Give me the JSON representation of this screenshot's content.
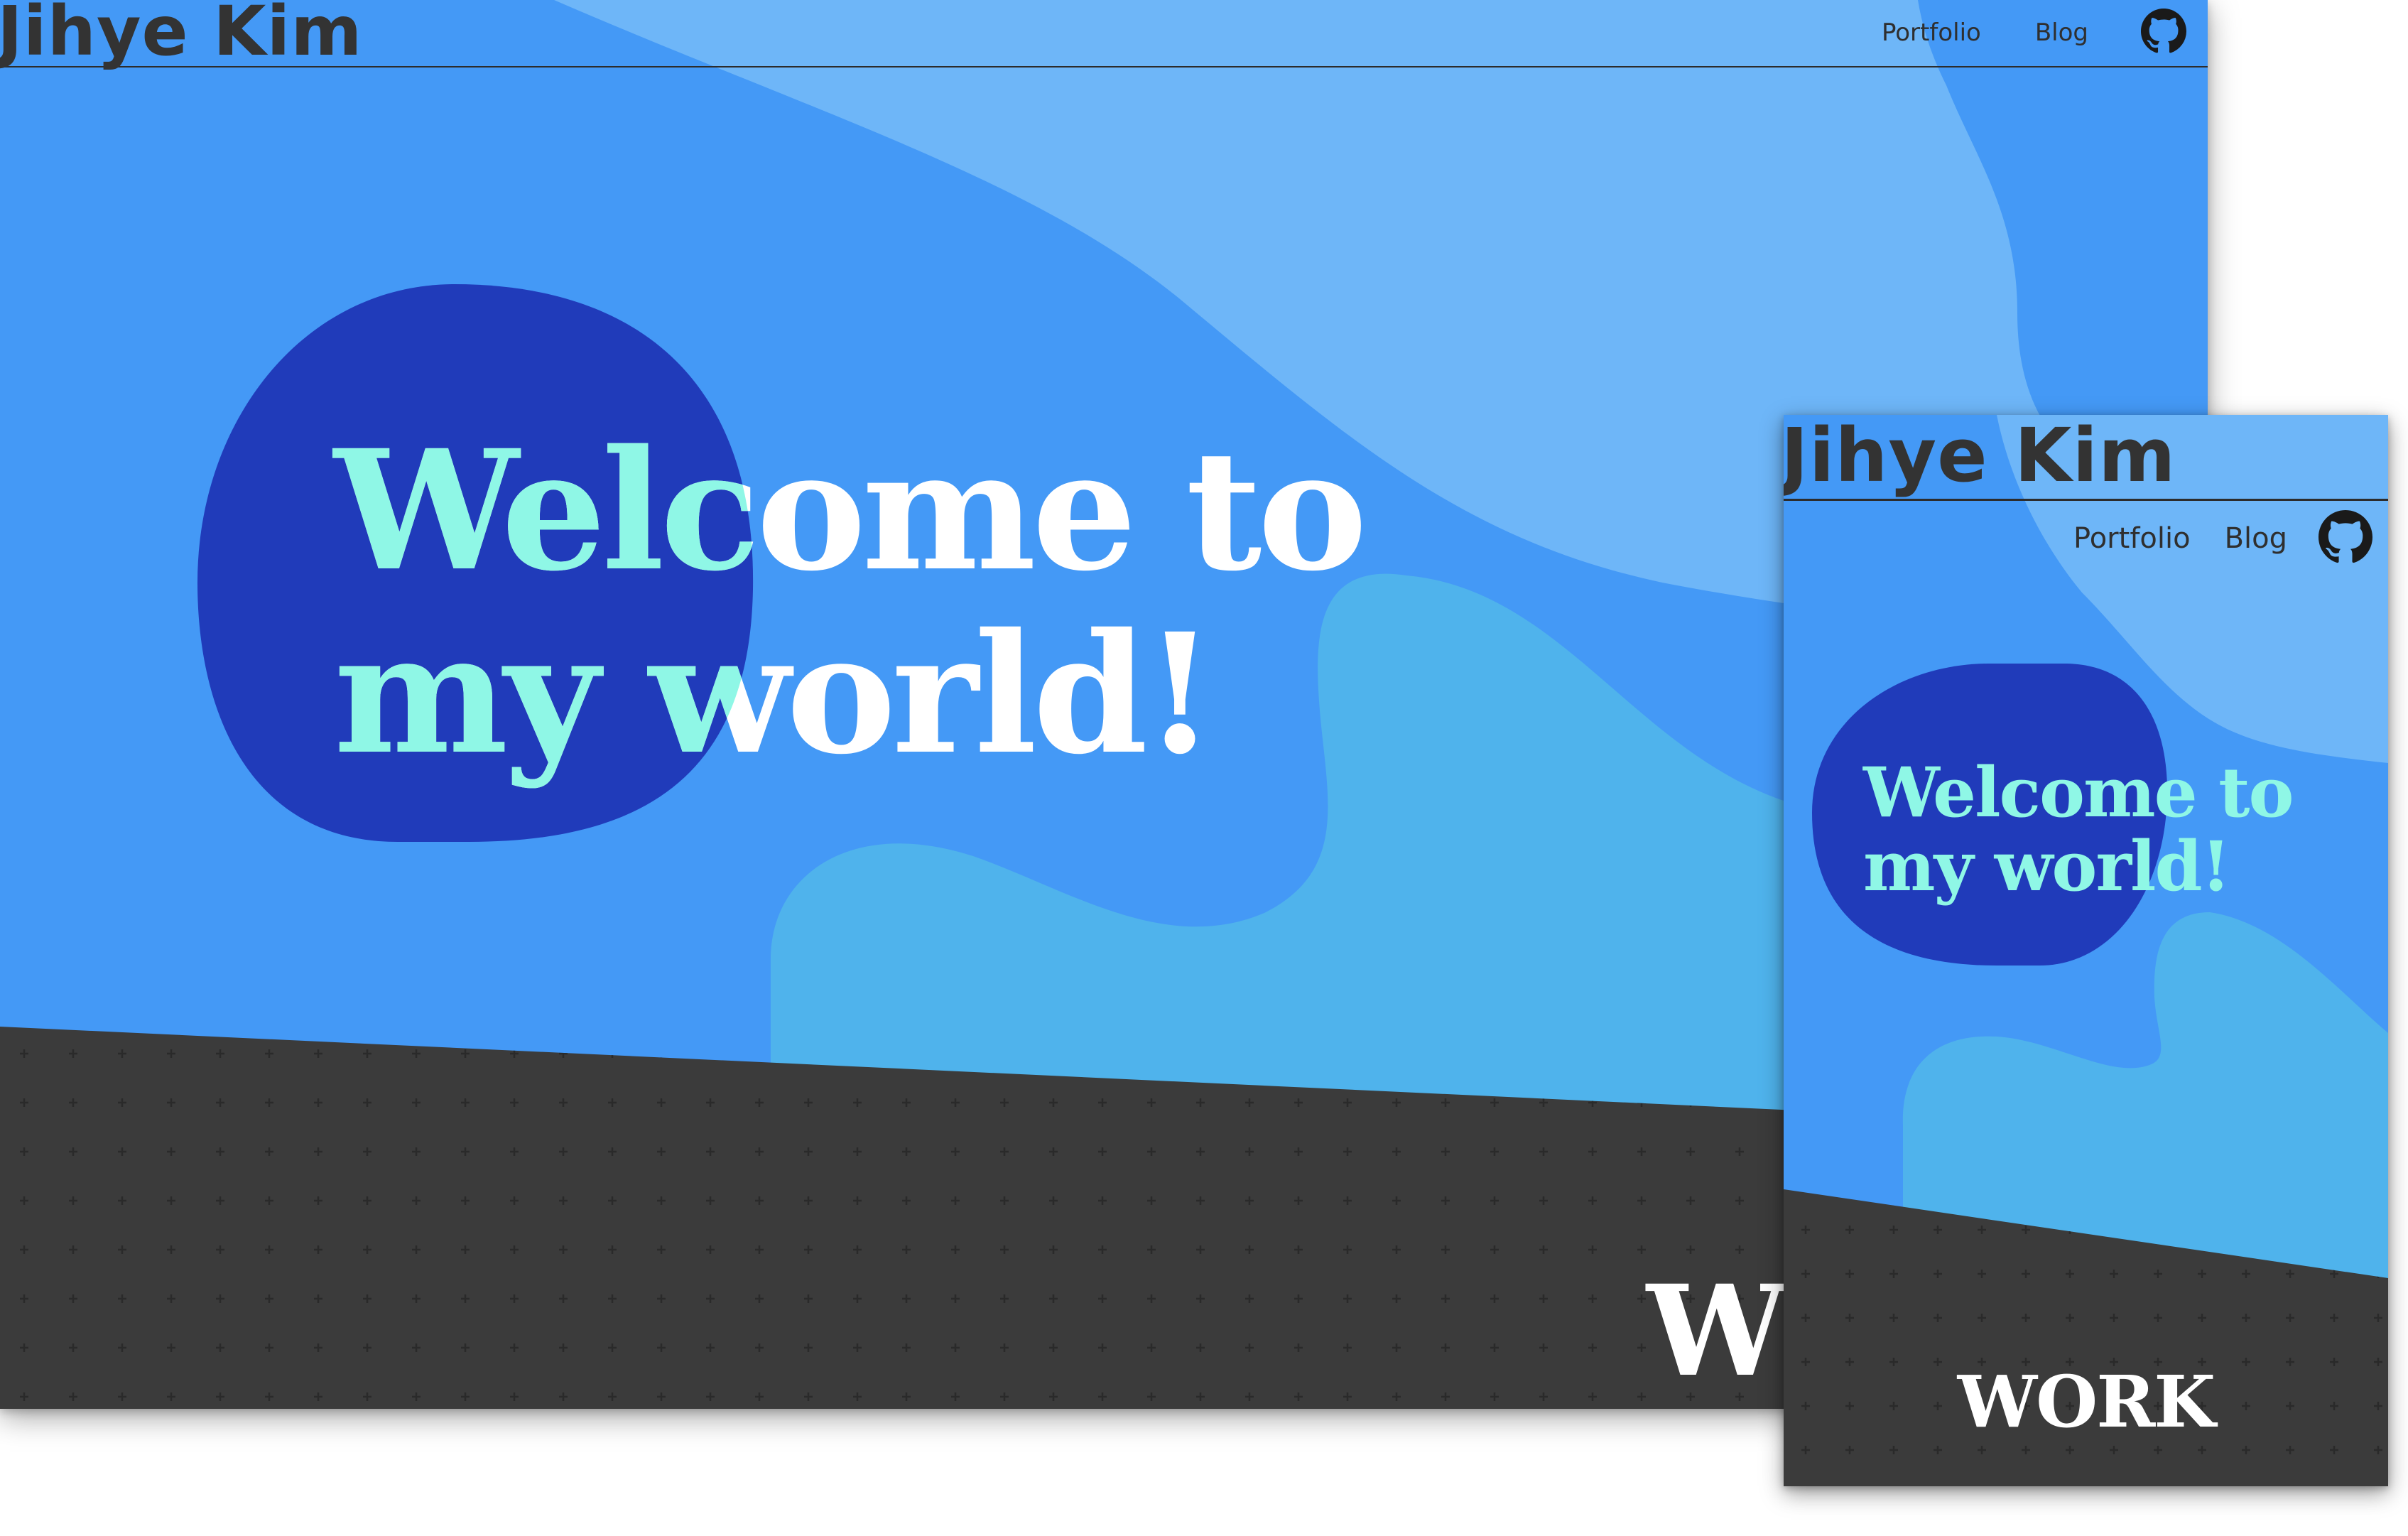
{
  "site": {
    "logo": "Jihye Kim",
    "nav": {
      "portfolio": "Portfolio",
      "blog": "Blog",
      "github_icon": "github-icon"
    },
    "hero": {
      "line1": "Welcome to",
      "line2": "my world!"
    },
    "section": {
      "work_label": "WORK"
    }
  },
  "desktop": {
    "logo": "Jihye Kim",
    "nav": {
      "portfolio": "Portfolio",
      "blog": "Blog"
    },
    "work_partial": "WO"
  },
  "colors": {
    "page_bg": "#4499f6",
    "wave_light": "#6eb6f8",
    "wave_teal": "#4fb3ec",
    "blob_dark": "#203bba",
    "hero_text_mint": "#8ff7e6",
    "hero_text_white": "#ffffff",
    "dark_section": "#3b3b3b",
    "logo_text": "#333333"
  }
}
